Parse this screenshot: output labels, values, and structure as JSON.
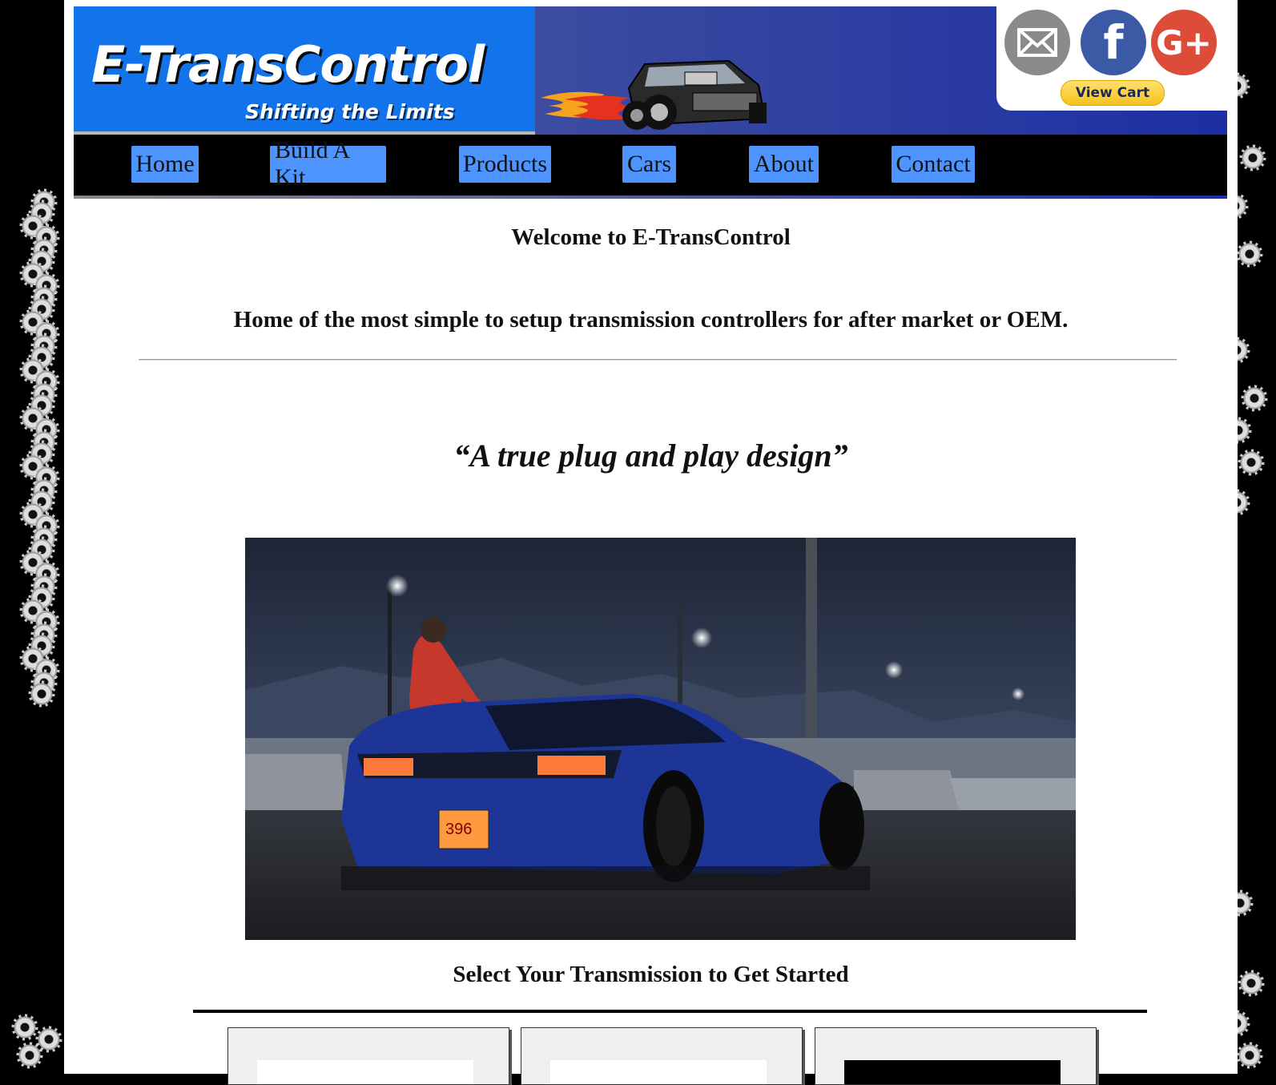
{
  "header": {
    "logo_title": "E-TransControl",
    "logo_tagline": "Shifting the Limits",
    "cart_label": "View Cart",
    "social": [
      {
        "name": "email",
        "icon": "mail-icon",
        "color": "#8a8a8a"
      },
      {
        "name": "facebook",
        "icon": "facebook-icon",
        "glyph": "f",
        "color": "#3b5aa6"
      },
      {
        "name": "google-plus",
        "icon": "google-plus-icon",
        "glyph": "G+",
        "color": "#dd4b39"
      }
    ]
  },
  "nav": {
    "items": [
      {
        "label": "Home"
      },
      {
        "label": "Build A Kit"
      },
      {
        "label": "Products"
      },
      {
        "label": "Cars"
      },
      {
        "label": "About"
      },
      {
        "label": "Contact"
      }
    ],
    "button_color": "#4d94ff"
  },
  "main": {
    "welcome": "Welcome to E-TransControl",
    "subtitle": "Home of the most simple to setup transmission controllers for after market or OEM.",
    "quote": "“A true plug and play design”",
    "select_heading": "Select Your Transmission to Get Started",
    "hero_plate": "396"
  },
  "colors": {
    "logo_blue": "#1273ea",
    "header_gradient_end": "#1c2fa3",
    "car_body": "#1e3aa8"
  }
}
